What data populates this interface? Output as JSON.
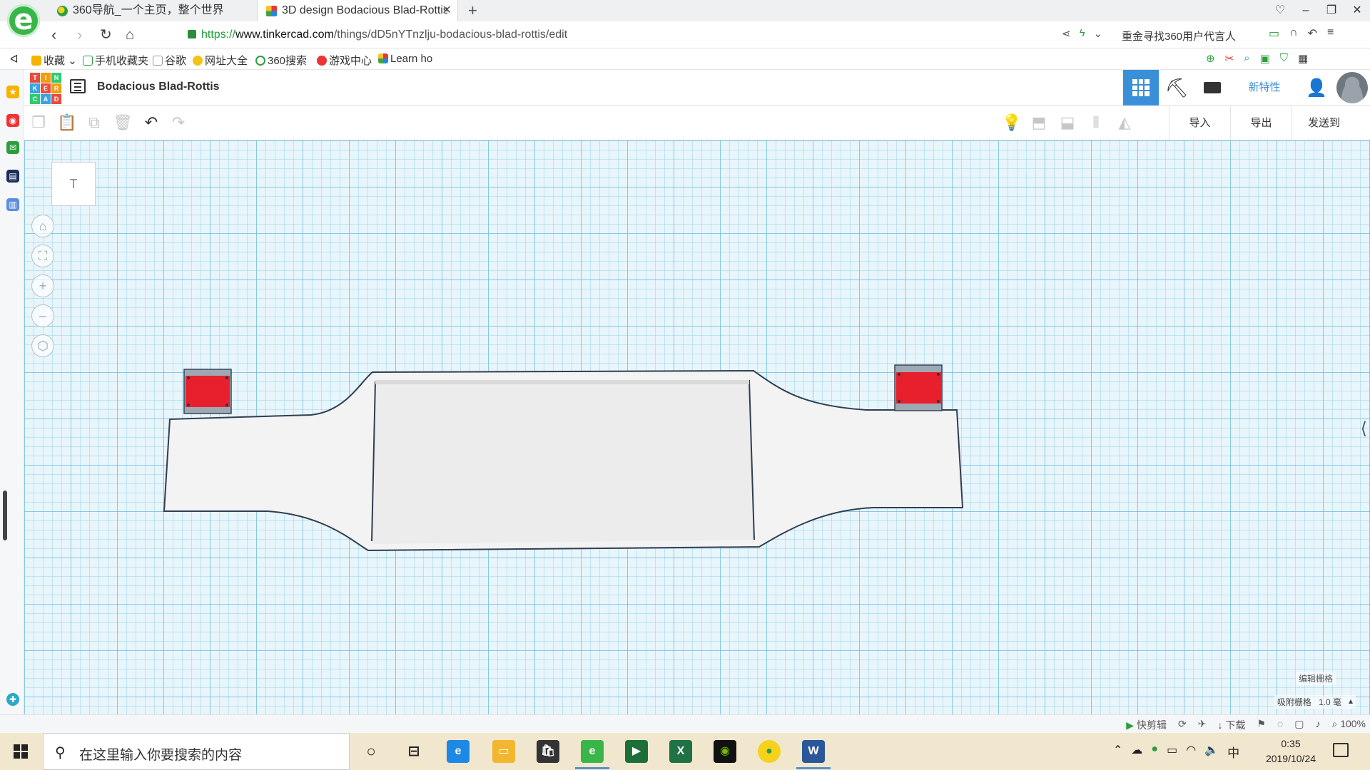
{
  "browser": {
    "tabs": [
      {
        "title": "360导航_一个主页，整个世界"
      },
      {
        "title": "3D design Bodacious Blad-Rottis"
      }
    ],
    "url": {
      "proto": "https://",
      "host": "www.tinkercad.com",
      "path": "/things/dD5nYTnzlju-bodacious-blad-rottis/edit"
    },
    "promo": "重金寻找360用户代言人",
    "bookmarks": [
      "收藏",
      "手机收藏夹",
      "谷歌",
      "网址大全",
      "360搜索",
      "游戏中心",
      "Learn ho"
    ]
  },
  "tinkercad": {
    "logo_letters": [
      "T",
      "I",
      "N",
      "K",
      "E",
      "R",
      "C",
      "A",
      "D"
    ],
    "design_title": "Bodacious Blad-Rottis",
    "new_features": "新特性",
    "toolbar": {
      "import": "导入",
      "export": "导出",
      "send_to": "发送到"
    },
    "viewcube_label": "T",
    "grid_settings": "编辑栅格",
    "snap_label": "吸附栅格",
    "snap_value": "1.0 毫"
  },
  "statusbar": {
    "clip": "快剪辑",
    "download": "下载",
    "zoom": "100%"
  },
  "taskbar": {
    "search_placeholder": "在这里输入你要搜索的内容",
    "time": "0:35",
    "date": "2019/10/24",
    "ime": "中"
  },
  "colors": {
    "accent": "#3a8fd9",
    "part_red": "#e8202e",
    "outline": "#2f3e52"
  }
}
